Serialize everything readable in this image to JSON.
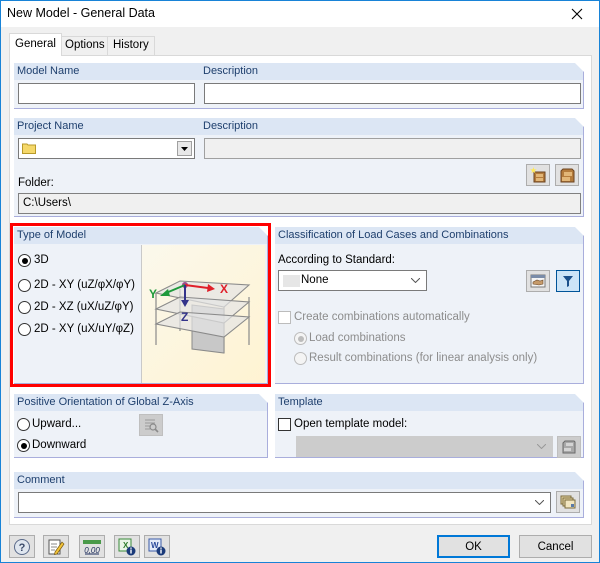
{
  "window": {
    "title": "New Model - General Data",
    "close_label": "Close"
  },
  "tabs": [
    {
      "label": "General",
      "active": true
    },
    {
      "label": "Options",
      "active": false
    },
    {
      "label": "History",
      "active": false
    }
  ],
  "model": {
    "name_label": "Model Name",
    "name_value": "",
    "description_label": "Description",
    "description_value": ""
  },
  "project": {
    "name_label": "Project Name",
    "name_value": "",
    "description_label": "Description",
    "description_value": "",
    "folder_label": "Folder:",
    "folder_value": "C:\\Users\\",
    "new_project_tooltip": "New project",
    "project_manager_tooltip": "Project manager"
  },
  "type_of_model": {
    "header": "Type of Model",
    "options": [
      {
        "label": "3D",
        "checked": true
      },
      {
        "label": "2D - XY (uZ/φX/φY)",
        "checked": false
      },
      {
        "label": "2D - XZ (uX/uZ/φY)",
        "checked": false
      },
      {
        "label": "2D - XY (uX/uY/φZ)",
        "checked": false
      }
    ],
    "axes": {
      "x": "X",
      "y": "Y",
      "z": "Z"
    }
  },
  "classification": {
    "header": "Classification of Load Cases and Combinations",
    "standard_label": "According to Standard:",
    "standard_value": "None",
    "create_auto_label": "Create combinations automatically",
    "create_auto_checked": false,
    "options": [
      {
        "label": "Load combinations",
        "checked": true
      },
      {
        "label": "Result combinations (for linear analysis only)",
        "checked": false
      }
    ]
  },
  "z_axis": {
    "header": "Positive Orientation of Global Z-Axis",
    "options": [
      {
        "label": "Upward...",
        "checked": false
      },
      {
        "label": "Downward",
        "checked": true
      }
    ]
  },
  "template": {
    "header": "Template",
    "open_label": "Open template model:",
    "open_checked": false,
    "value": ""
  },
  "comment": {
    "header": "Comment",
    "value": ""
  },
  "footer": {
    "ok_label": "OK",
    "cancel_label": "Cancel",
    "units_text": "0,00"
  },
  "colors": {
    "accent": "#0078d7",
    "group_header_bg": "#dce6f4",
    "group_header_text": "#1e3f6d",
    "highlight_frame": "#ff0000"
  }
}
